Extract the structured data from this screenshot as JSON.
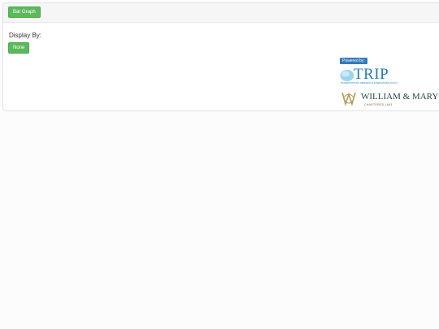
{
  "toolbar": {
    "chart_button_label": "Bar Graph"
  },
  "display": {
    "label": "Display By:",
    "selected_label": "None"
  },
  "branding": {
    "powered_by": "Powered by:",
    "trip_logo": "TRIP",
    "trip_tagline": "TRANSPORTATION, RESEARCH & INTERNATIONAL POLICY",
    "university_logo": "WILLIAM & MARY",
    "university_tagline": "CHARTERED 1693"
  },
  "colors": {
    "button_green": "#5cb85c",
    "powered_blue": "#337ab7",
    "trip_blue": "#1f7bc0",
    "wm_green": "#1d4a3c",
    "wm_gold": "#b59a57"
  }
}
